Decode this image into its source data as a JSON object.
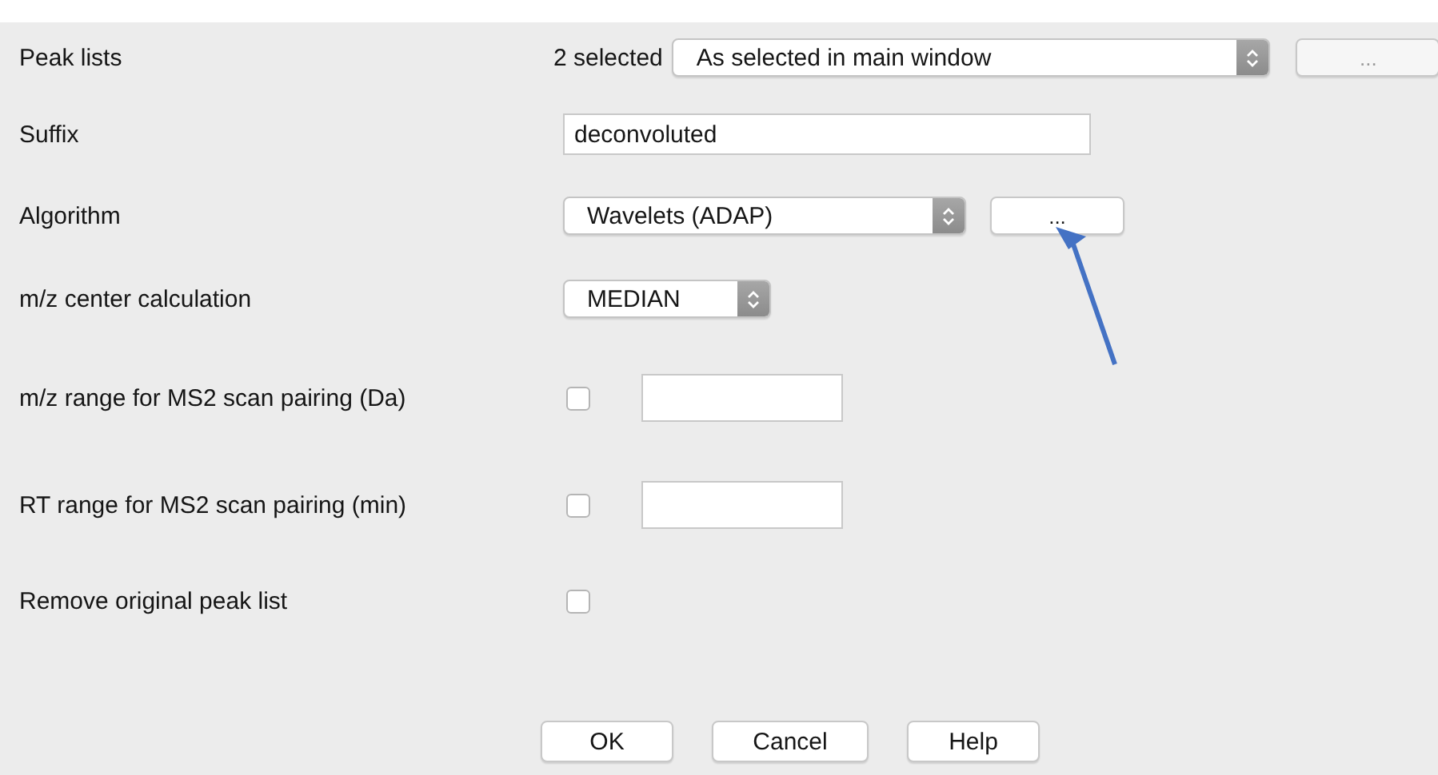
{
  "rows": [
    {
      "kind": "combo",
      "label": "Peak lists",
      "prefix": "2 selected",
      "value": "As selected in main window",
      "button": {
        "label": "...",
        "disabled": true
      }
    },
    {
      "kind": "text",
      "label": "Suffix",
      "value": "deconvoluted"
    },
    {
      "kind": "combo",
      "label": "Algorithm",
      "value": "Wavelets (ADAP)",
      "button": {
        "label": "...",
        "disabled": false
      }
    },
    {
      "kind": "combo",
      "label": "m/z center calculation",
      "value": "MEDIAN"
    },
    {
      "kind": "check_field",
      "label": "m/z range for MS2 scan pairing (Da)",
      "checked": false
    },
    {
      "kind": "check_field",
      "label": "RT range for MS2 scan pairing (min)",
      "checked": false
    },
    {
      "kind": "check",
      "label": "Remove original peak list",
      "checked": false
    }
  ],
  "buttons": [
    "OK",
    "Cancel",
    "Help"
  ]
}
